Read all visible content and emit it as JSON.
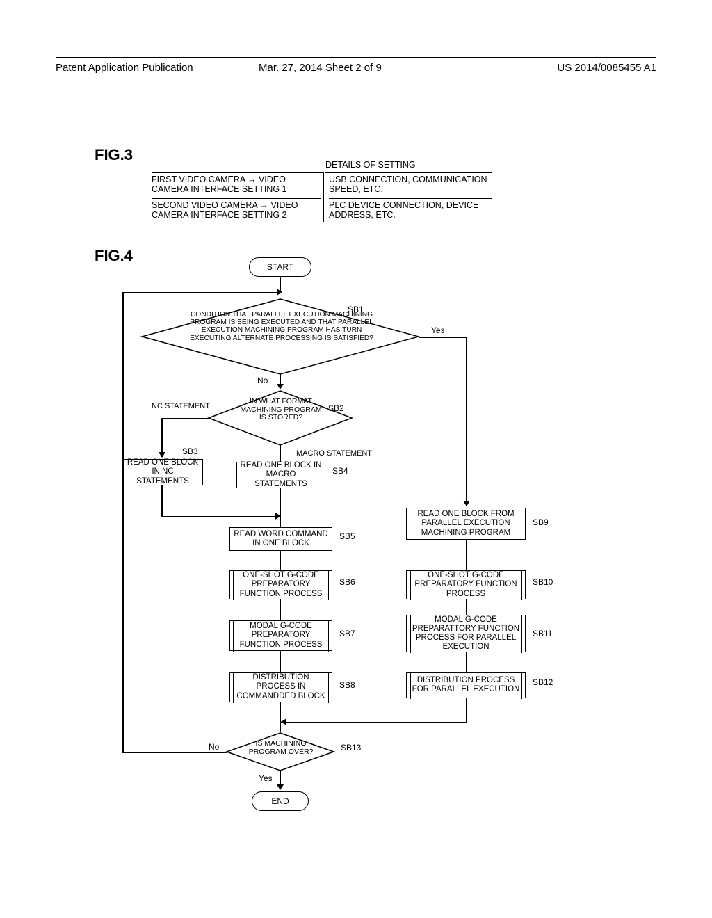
{
  "header": {
    "left": "Patent Application Publication",
    "mid": "Mar. 27, 2014  Sheet 2 of 9",
    "right": "US 2014/0085455 A1"
  },
  "fig3": {
    "label": "FIG.3",
    "head": "DETAILS OF SETTING",
    "r1c1": "FIRST VIDEO CAMERA → VIDEO CAMERA  INTERFACE SETTING 1",
    "r1c2": "USB CONNECTION, COMMUNICATION SPEED, ETC.",
    "r2c1": "SECOND VIDEO CAMERA → VIDEO CAMERA INTERFACE SETTING 2",
    "r2c2": "PLC DEVICE CONNECTION, DEVICE ADDRESS, ETC."
  },
  "fig4": {
    "label": "FIG.4",
    "start": "START",
    "end": "END",
    "sb1": "CONDITION THAT PARALLEL EXECUTION MACHINING PROGRAM IS BEING EXECUTED AND THAT PARALLEL EXECUTION MACHINING PROGRAM HAS TURN EXECUTING ALTERNATE PROCESSING IS SATISFIED?",
    "sb1_tag": "SB1",
    "sb1_yes": "Yes",
    "sb1_no": "No",
    "sb2": "IN WHAT FORMAT MACHINING PROGRAM IS STORED?",
    "sb2_tag": "SB2",
    "sb2_left": "NC STATEMENT",
    "sb2_right": "MACRO STATEMENT",
    "sb3": "READ ONE BLOCK IN NC STATEMENTS",
    "sb3_tag": "SB3",
    "sb4": "READ ONE BLOCK IN MACRO STATEMENTS",
    "sb4_tag": "SB4",
    "sb5": "READ WORD COMMAND IN ONE BLOCK",
    "sb5_tag": "SB5",
    "sb6": "ONE-SHOT G-CODE PREPARATORY FUNCTION PROCESS",
    "sb6_tag": "SB6",
    "sb7": "MODAL G-CODE PREPARATORY FUNCTION PROCESS",
    "sb7_tag": "SB7",
    "sb8": "DISTRIBUTION PROCESS IN COMMANDDED BLOCK",
    "sb8_tag": "SB8",
    "sb9": "READ ONE BLOCK FROM PARALLEL EXECUTION MACHINING PROGRAM",
    "sb9_tag": "SB9",
    "sb10": "ONE-SHOT G-CODE PREPARATORY FUNCTION PROCESS",
    "sb10_tag": "SB10",
    "sb11": "MODAL G-CODE PREPARATTORY FUNCTION PROCESS FOR PARALLEL EXECUTION",
    "sb11_tag": "SB11",
    "sb12": "DISTRIBUTION PROCESS FOR PARALLEL EXECUTION",
    "sb12_tag": "SB12",
    "sb13": "IS MACHINING PROGRAM OVER?",
    "sb13_tag": "SB13",
    "sb13_yes": "Yes",
    "sb13_no": "No"
  }
}
